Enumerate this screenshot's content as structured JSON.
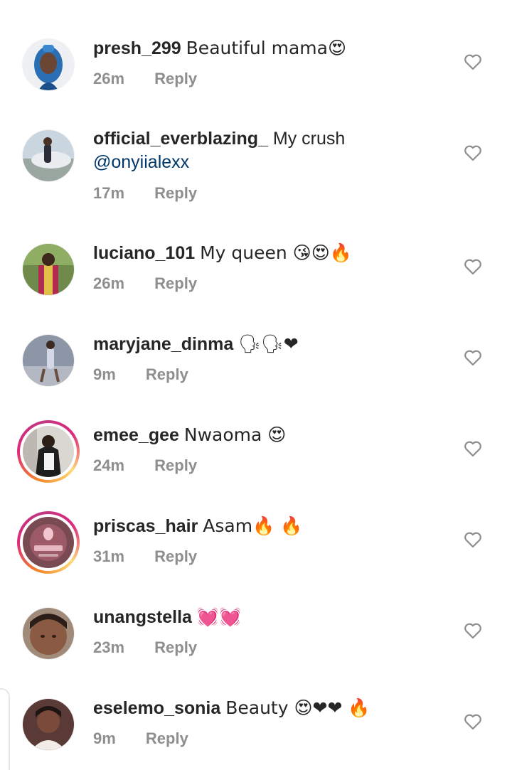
{
  "comments": [
    {
      "username": "presh_299",
      "text": "Beautiful mama😍",
      "mention": "",
      "time": "26m",
      "reply_label": "Reply",
      "avatar": "woman-blue-scarf",
      "story_ring": false
    },
    {
      "username": "official_everblazing_",
      "text": "My crush",
      "mention": "@onyiialexx",
      "time": "17m",
      "reply_label": "Reply",
      "avatar": "man-with-car",
      "story_ring": false
    },
    {
      "username": "luciano_101",
      "text": "My queen 😘😍🔥",
      "mention": "",
      "time": "26m",
      "reply_label": "Reply",
      "avatar": "man-colorful-outfit",
      "story_ring": false
    },
    {
      "username": "maryjane_dinma",
      "text": "🗣🗣❤",
      "mention": "",
      "time": "9m",
      "reply_label": "Reply",
      "avatar": "woman-posing-street",
      "story_ring": false
    },
    {
      "username": "emee_gee",
      "text": "Nwaoma 😍",
      "mention": "",
      "time": "24m",
      "reply_label": "Reply",
      "avatar": "person-printed-jacket",
      "story_ring": true
    },
    {
      "username": "priscas_hair",
      "text": "Asam🔥 🔥",
      "mention": "",
      "time": "31m",
      "reply_label": "Reply",
      "avatar": "salon-logo",
      "story_ring": true
    },
    {
      "username": "unangstella",
      "text": "💓💓",
      "mention": "",
      "time": "23m",
      "reply_label": "Reply",
      "avatar": "woman-closeup",
      "story_ring": false
    },
    {
      "username": "eselemo_sonia",
      "text": "Beauty 😍❤❤ 🔥",
      "mention": "",
      "time": "9m",
      "reply_label": "Reply",
      "avatar": "woman-portrait",
      "story_ring": false
    }
  ],
  "colors": {
    "text": "#262626",
    "meta": "#8e8e8e",
    "mention": "#00376b",
    "heart_outline": "#8e8e8e"
  },
  "icons": {
    "like": "heart-outline-icon"
  }
}
